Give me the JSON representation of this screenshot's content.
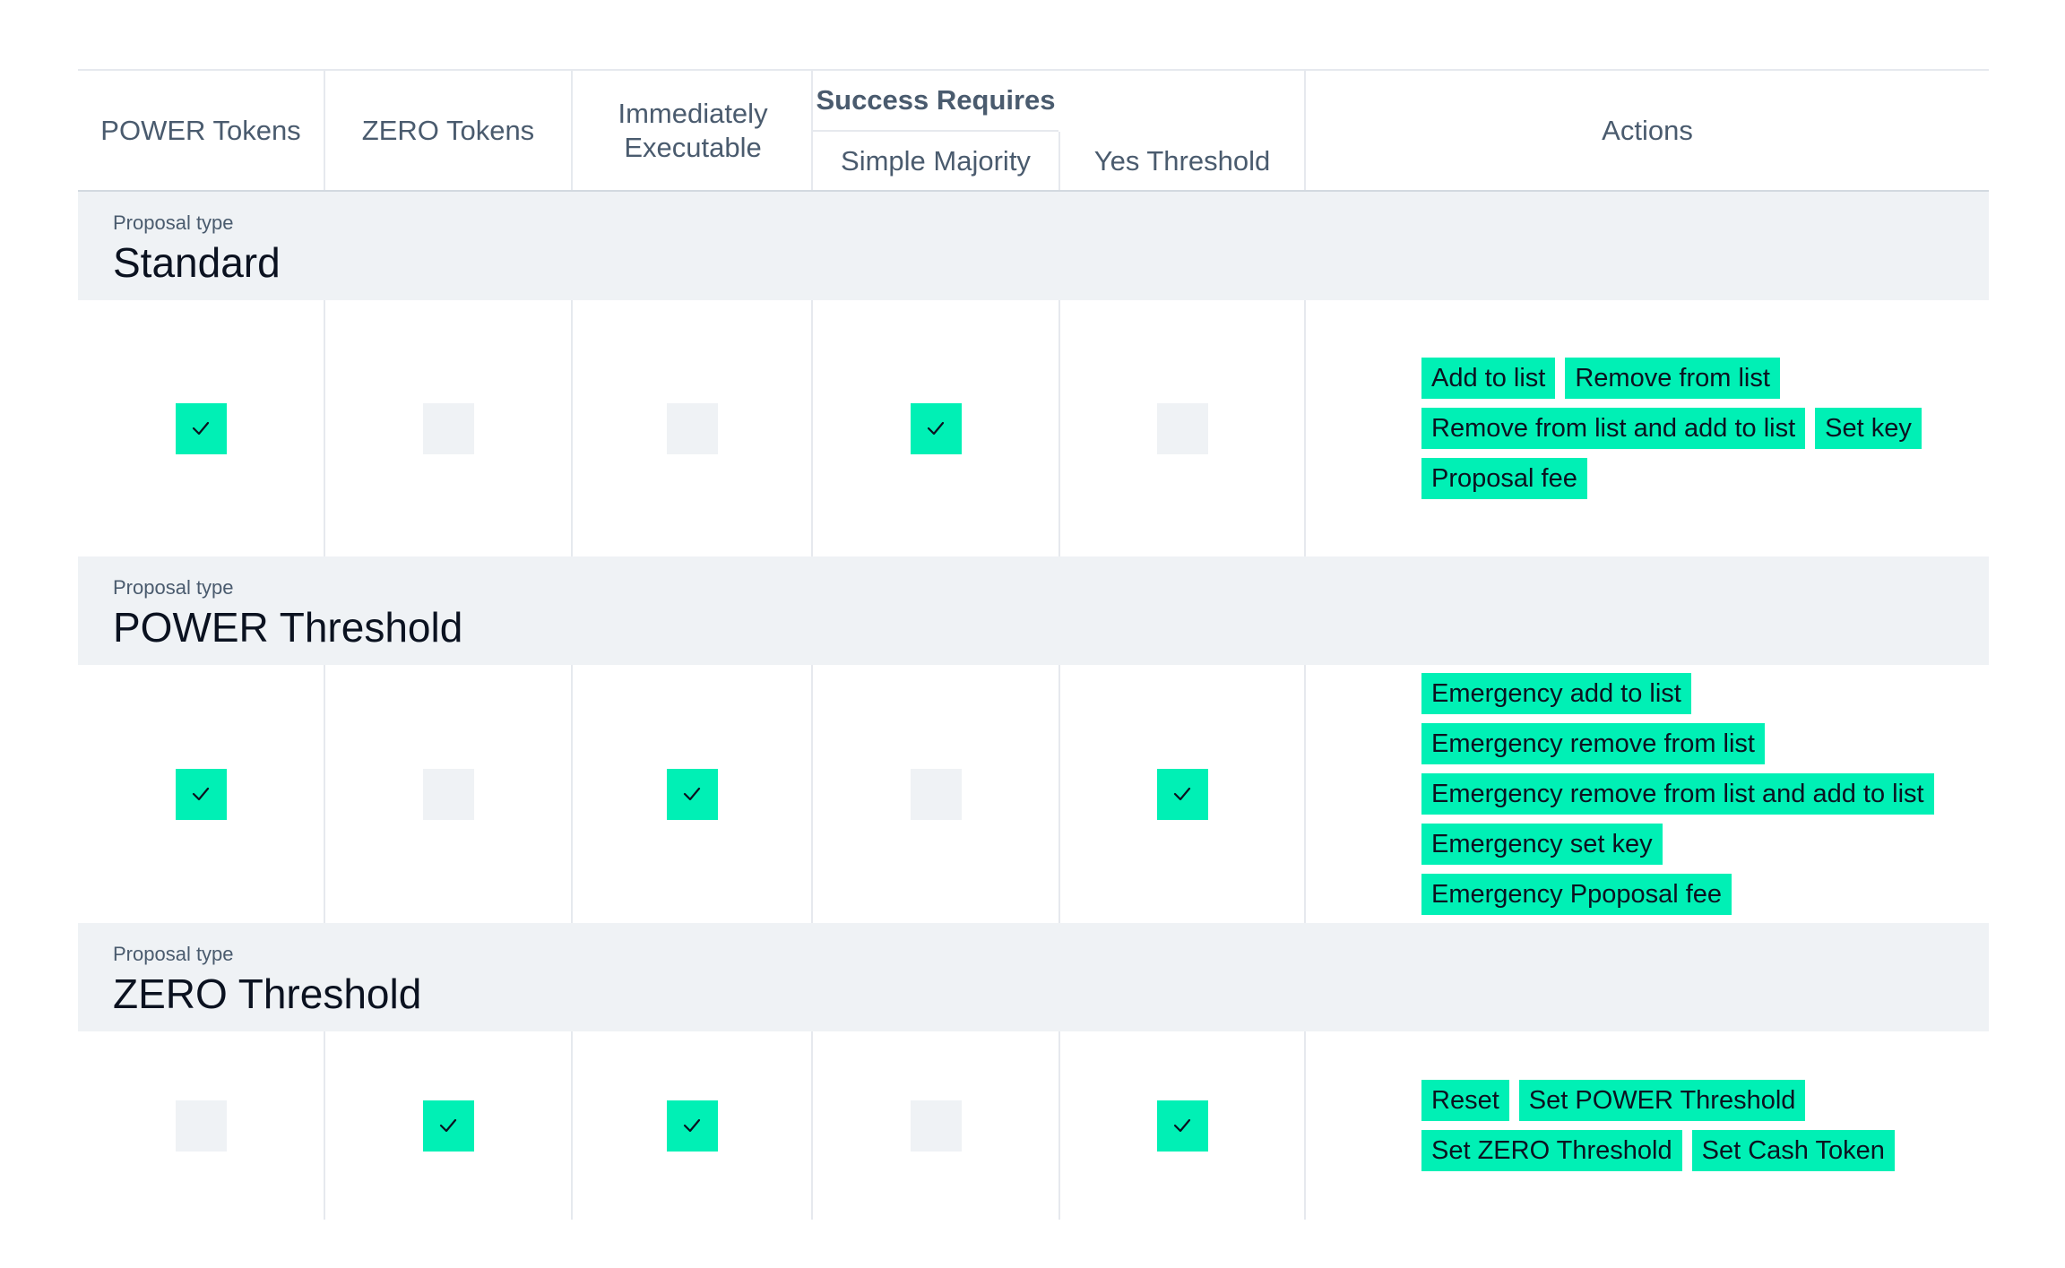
{
  "header": {
    "power_tokens": "POWER Tokens",
    "zero_tokens": "ZERO Tokens",
    "immediately_executable": "Immediately Executable",
    "success_requires": "Success Requires",
    "simple_majority": "Simple Majority",
    "yes_threshold": "Yes Threshold",
    "actions": "Actions"
  },
  "colors": {
    "accent": "#00f0b5",
    "band": "#eff2f5",
    "header_text": "#4a5b6e"
  },
  "sections": [
    {
      "label": "Proposal type",
      "name": "Standard",
      "checks": {
        "power": true,
        "zero": false,
        "immediate": false,
        "majority": true,
        "threshold": false
      },
      "actions": [
        "Add to list",
        "Remove from list",
        "Remove from list and add to list",
        "Set key",
        "Proposal fee"
      ]
    },
    {
      "label": "Proposal type",
      "name": "POWER Threshold",
      "checks": {
        "power": true,
        "zero": false,
        "immediate": true,
        "majority": false,
        "threshold": true
      },
      "actions": [
        "Emergency add to list",
        "Emergency remove from list",
        "Emergency remove from list and add to list",
        "Emergency set key",
        "Emergency Ppoposal fee"
      ]
    },
    {
      "label": "Proposal type",
      "name": "ZERO Threshold",
      "checks": {
        "power": false,
        "zero": true,
        "immediate": true,
        "majority": false,
        "threshold": true
      },
      "actions": [
        "Reset",
        "Set POWER Threshold",
        "Set ZERO Threshold",
        "Set Cash Token"
      ]
    }
  ]
}
